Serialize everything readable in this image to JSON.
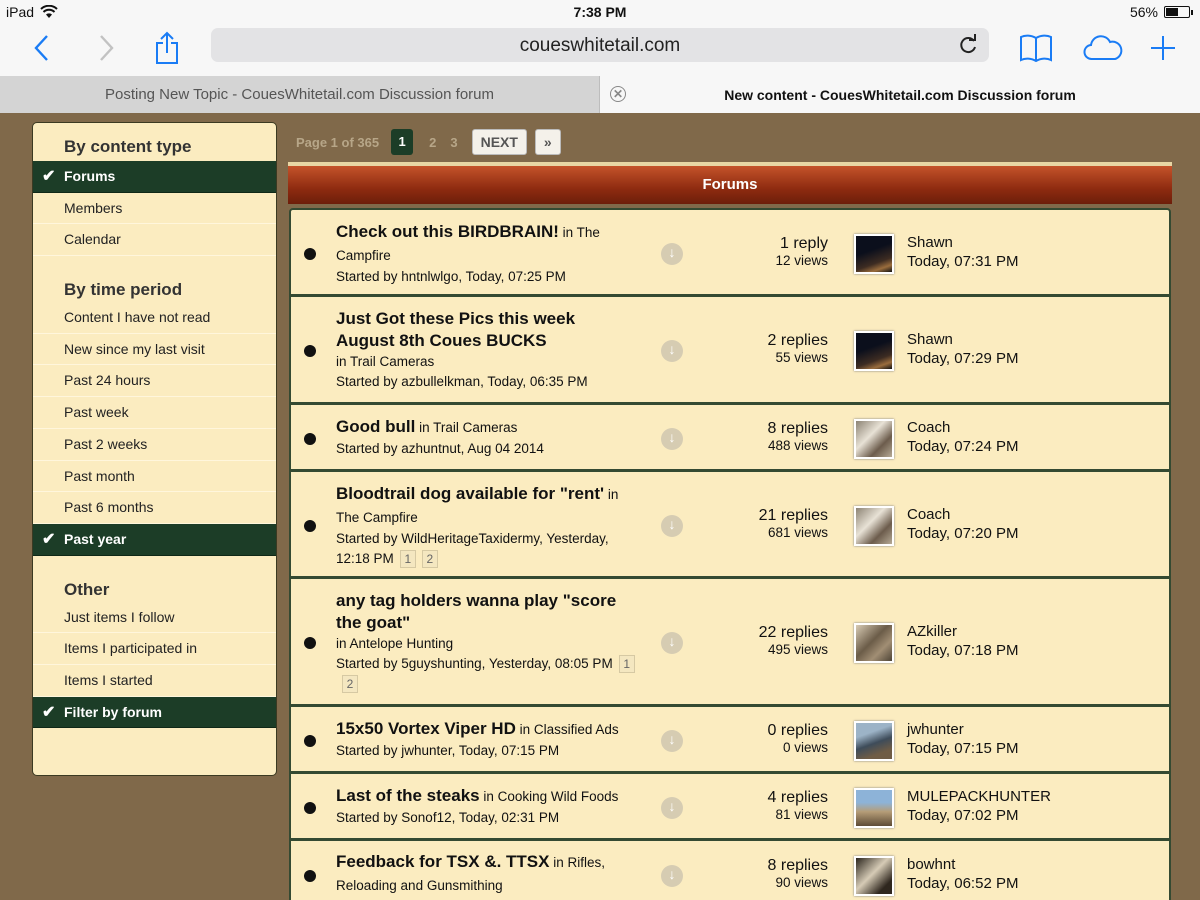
{
  "status_bar": {
    "device": "iPad",
    "time": "7:38 PM",
    "battery_text": "56%",
    "battery_level": 0.56
  },
  "toolbar": {
    "url": "coueswhitetail.com"
  },
  "tabs": [
    {
      "label": "Posting New Topic - CouesWhitetail.com Discussion forum",
      "active": false
    },
    {
      "label": "New content - CouesWhitetail.com Discussion forum",
      "active": true
    }
  ],
  "sidebar": {
    "sections": [
      {
        "heading": "By content type",
        "items": [
          {
            "label": "Forums",
            "selected": true
          },
          {
            "label": "Members",
            "selected": false
          },
          {
            "label": "Calendar",
            "selected": false
          }
        ]
      },
      {
        "heading": "By time period",
        "items": [
          {
            "label": "Content I have not read",
            "selected": false
          },
          {
            "label": "New since my last visit",
            "selected": false
          },
          {
            "label": "Past 24 hours",
            "selected": false
          },
          {
            "label": "Past week",
            "selected": false
          },
          {
            "label": "Past 2 weeks",
            "selected": false
          },
          {
            "label": "Past month",
            "selected": false
          },
          {
            "label": "Past 6 months",
            "selected": false
          },
          {
            "label": "Past year",
            "selected": true
          }
        ]
      },
      {
        "heading": "Other",
        "items": [
          {
            "label": "Just items I follow",
            "selected": false
          },
          {
            "label": "Items I participated in",
            "selected": false
          },
          {
            "label": "Items I started",
            "selected": false
          },
          {
            "label": "Filter by forum",
            "selected": true
          }
        ]
      }
    ],
    "check_glyph": "✔"
  },
  "pagination": {
    "label": "Page 1 of 365",
    "pages": [
      "1",
      "2",
      "3"
    ],
    "current": "1",
    "next_label": "NEXT",
    "last_label": "»"
  },
  "forums_header": "Forums",
  "colors": {
    "accent_green": "#1c3d27",
    "panel_cream": "#fbecc0",
    "page_brown": "#80694a",
    "header_red": "#8e2b10"
  },
  "topics": [
    {
      "title": "Check out this BIRDBRAIN!",
      "in_text": " in The Campfire",
      "started": "Started by hntnlwlgo, Today, 07:25 PM",
      "subpages": [],
      "replies": "1 reply",
      "views": "12 views",
      "avatar": "night-sky-avatar",
      "last_user": "Shawn",
      "last_time": "Today, 07:31 PM"
    },
    {
      "title": "Just Got these Pics this week August 8th Coues BUCKS",
      "in_text": "in Trail Cameras",
      "started": "Started by azbullelkman, Today, 06:35 PM",
      "subpages": [],
      "replies": "2 replies",
      "views": "55 views",
      "avatar": "night-sky-avatar",
      "last_user": "Shawn",
      "last_time": "Today, 07:29 PM"
    },
    {
      "title": "Good bull",
      "in_text": " in Trail Cameras",
      "started": "Started by azhuntnut, Aug 04 2014",
      "subpages": [],
      "replies": "8 replies",
      "views": "488 views",
      "avatar": "antler-avatar",
      "last_user": "Coach",
      "last_time": "Today, 07:24 PM"
    },
    {
      "title": "Bloodtrail dog available for \"rent'",
      "in_text": " in The Campfire",
      "started": "Started by WildHeritageTaxidermy, Yesterday, 12:18 PM",
      "subpages": [
        "1",
        "2"
      ],
      "replies": "21 replies",
      "views": "681 views",
      "avatar": "antler-avatar",
      "last_user": "Coach",
      "last_time": "Today, 07:20 PM"
    },
    {
      "title": "any tag holders wanna play \"score the goat\"",
      "in_text": "in Antelope Hunting",
      "started": "Started by 5guyshunting, Yesterday, 08:05 PM",
      "subpages": [
        "1",
        "2"
      ],
      "replies": "22 replies",
      "views": "495 views",
      "avatar": "hunter-avatar",
      "last_user": "AZkiller",
      "last_time": "Today, 07:18 PM"
    },
    {
      "title": "15x50 Vortex Viper HD",
      "in_text": " in Classified Ads",
      "started": "Started by jwhunter, Today, 07:15 PM",
      "subpages": [],
      "replies": "0 replies",
      "views": "0 views",
      "avatar": "outdoor-avatar",
      "last_user": "jwhunter",
      "last_time": "Today, 07:15 PM"
    },
    {
      "title": "Last of the steaks",
      "in_text": " in Cooking Wild Foods",
      "started": "Started by Sonof12, Today, 02:31 PM",
      "subpages": [],
      "replies": "4 replies",
      "views": "81 views",
      "avatar": "mountain-avatar",
      "last_user": "MULEPACKHUNTER",
      "last_time": "Today, 07:02 PM"
    },
    {
      "title": "Feedback for TSX &. TTSX",
      "in_text": " in Rifles, Reloading and Gunsmithing",
      "started": "",
      "subpages": [],
      "replies": "8 replies",
      "views": "90 views",
      "avatar": "deer-avatar",
      "last_user": "bowhnt",
      "last_time": "Today, 06:52 PM"
    }
  ]
}
